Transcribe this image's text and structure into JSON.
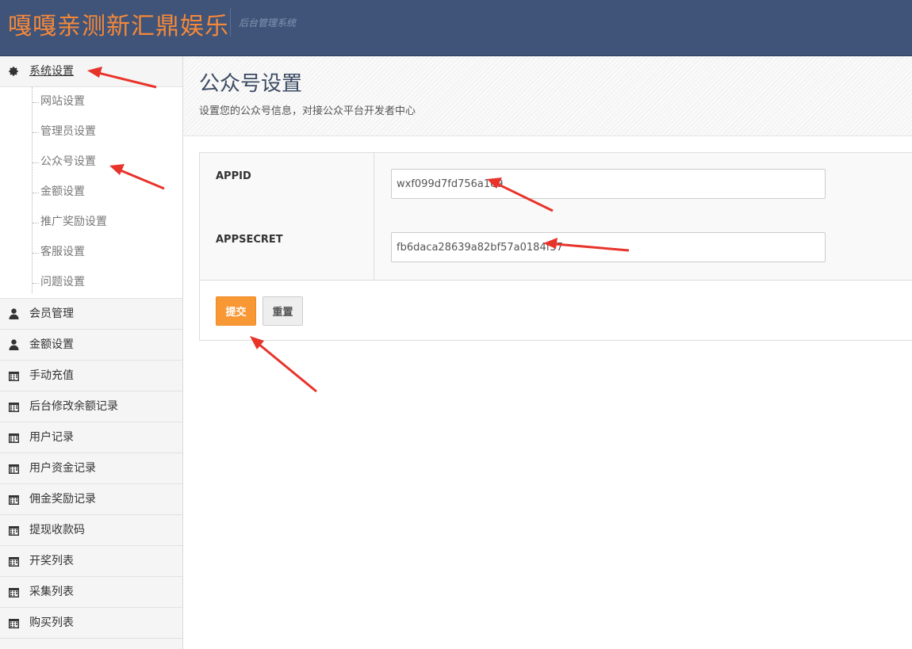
{
  "header": {
    "brand": "嘎嘎亲测新汇鼎娱乐",
    "subtitle": "后台管理系统",
    "bg_color": "#3f5478",
    "brand_color": "#f5883a"
  },
  "sidebar": {
    "settings": {
      "label": "系统设置",
      "icon": "gear-icon",
      "sub_items": [
        {
          "label": "网站设置"
        },
        {
          "label": "管理员设置"
        },
        {
          "label": "公众号设置"
        },
        {
          "label": "金额设置"
        },
        {
          "label": "推广奖励设置"
        },
        {
          "label": "客服设置"
        },
        {
          "label": "问题设置"
        }
      ]
    },
    "items": [
      {
        "label": "会员管理",
        "icon": "user-icon"
      },
      {
        "label": "金额设置",
        "icon": "user-icon"
      },
      {
        "label": "手动充值",
        "icon": "calendar-icon"
      },
      {
        "label": "后台修改余额记录",
        "icon": "calendar-icon"
      },
      {
        "label": "用户记录",
        "icon": "calendar-icon"
      },
      {
        "label": "用户资金记录",
        "icon": "calendar-icon"
      },
      {
        "label": "佣金奖励记录",
        "icon": "calendar-icon"
      },
      {
        "label": "提现收款码",
        "icon": "calendar-icon"
      },
      {
        "label": "开奖列表",
        "icon": "calendar-icon"
      },
      {
        "label": "采集列表",
        "icon": "calendar-icon"
      },
      {
        "label": "购买列表",
        "icon": "calendar-icon"
      }
    ]
  },
  "page": {
    "title": "公众号设置",
    "description": "设置您的公众号信息，对接公众平台开发者中心"
  },
  "form": {
    "appid_label": "APPID",
    "appid_value": "wxf099d7fd756a1e9",
    "appsecret_label": "APPSECRET",
    "appsecret_value": "fb6daca28639a82bf57a0184f37",
    "submit_label": "提交",
    "reset_label": "重置",
    "accent_color": "#f89835"
  },
  "annotations": {
    "arrow_color": "#e8332a"
  }
}
